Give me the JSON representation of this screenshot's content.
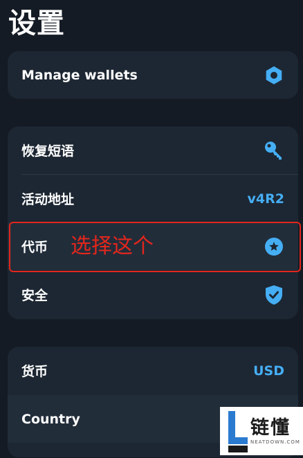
{
  "page": {
    "title": "设置"
  },
  "wallets_card": {
    "manage_wallets": "Manage wallets",
    "icon": "hexagon-gear-icon"
  },
  "settings_card": {
    "items": [
      {
        "label": "恢复短语",
        "icon": "key-icon"
      },
      {
        "label": "活动地址",
        "value": "v4R2"
      },
      {
        "label": "代币",
        "icon": "star-circle-icon"
      },
      {
        "label": "安全",
        "icon": "shield-check-icon"
      }
    ]
  },
  "prefs_card": {
    "items": [
      {
        "label": "货币",
        "value": "USD"
      },
      {
        "label": "Country"
      }
    ]
  },
  "annotation": {
    "text": "选择这个"
  },
  "watermark": {
    "cn": "链懂",
    "en": "NEATDOWN.COM"
  },
  "colors": {
    "background": "#141b24",
    "card": "#1d2733",
    "accent": "#45aef5",
    "annotation": "#e3261c"
  }
}
